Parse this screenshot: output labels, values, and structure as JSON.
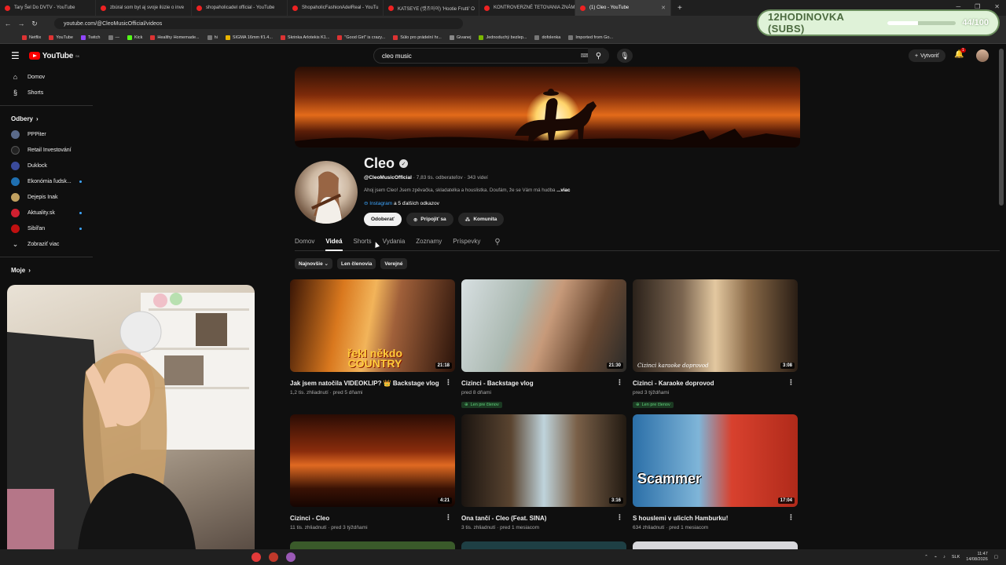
{
  "browser": {
    "tabs": [
      {
        "label": "Tary Šel Do DVTV - YouTube",
        "active": false
      },
      {
        "label": "zbúral som byt aj svoje ilúzie o inve",
        "active": false
      },
      {
        "label": "shopaholicadel official - YouTube",
        "active": false
      },
      {
        "label": "ShopaholicFashionAdelReal - YouTu",
        "active": false
      },
      {
        "label": "KATSEYE (캣츠아이) 'Hootie Frutti' O",
        "active": false
      },
      {
        "label": "KONTROVERZNÉ TETOVANIA ZNÁM",
        "active": false
      },
      {
        "label": "(1) Cleo - YouTube",
        "active": true
      }
    ],
    "url": "youtube.com/@CleoMusicOfficial/videos",
    "bookmarks": [
      "Netflix",
      "YouTube",
      "Twitch",
      "—",
      "Kick",
      "Healthy Homemade...",
      "hi",
      "SIGMA 16mm f/1.4...",
      "Skrinka Arlotekis K1...",
      "\"Good Girl\" is crazy...",
      "Súlo pro prádelní hr...",
      "Givanej",
      "Jednoduchý bezlep...",
      "dofolenka",
      "Imported from Go..."
    ]
  },
  "overlay": {
    "title": "12HODINOVKA (SUBS)",
    "count": "44/100",
    "progress": 0.44
  },
  "header": {
    "logo_text": "YouTube",
    "region": "SK",
    "search_value": "cleo music",
    "create_label": "Vytvoriť",
    "notif_count": "1"
  },
  "sidebar": {
    "main": [
      {
        "label": "Domov",
        "icon": "home-icon"
      },
      {
        "label": "Shorts",
        "icon": "shorts-icon"
      }
    ],
    "subs_title": "Odbery",
    "subs": [
      {
        "label": "PPPiter",
        "color": "#5a6a8a",
        "dot": false
      },
      {
        "label": "Retail Investování",
        "color": "#222222",
        "dot": false
      },
      {
        "label": "Duklock",
        "color": "#3a4a9a",
        "dot": false
      },
      {
        "label": "Ekonómia ľudsk...",
        "color": "#1f6fb0",
        "dot": true
      },
      {
        "label": "Dejepis Inak",
        "color": "#c0a060",
        "dot": false
      },
      {
        "label": "Aktuality.sk",
        "color": "#d02030",
        "dot": true
      },
      {
        "label": "Sibířan",
        "color": "#c01010",
        "dot": true
      }
    ],
    "show_more": "Zobraziť viac",
    "mine_title": "Moje"
  },
  "channel": {
    "name": "Cleo",
    "handle": "@CleoMusicOfficial",
    "stats": "· 7,83 tis. odberateľov · 343 videí",
    "description": "Ahoj jsem Cleo! Jsem zpěvačka, skladatelka a houslistka. Doufám, že se Vám má hudba",
    "more": "...viac",
    "link_label": "Instagram",
    "link_more": "a 5 ďalších odkazov",
    "buttons": {
      "subscribed": "Odoberať",
      "join": "Pripojiť sa",
      "community": "Komunita"
    }
  },
  "tabs": [
    "Domov",
    "Videá",
    "Shorts",
    "Vydania",
    "Zoznamy",
    "Príspevky"
  ],
  "active_tab": "Videá",
  "chips": [
    "Najnovšie",
    "Len členovia",
    "Verejné"
  ],
  "videos": [
    {
      "title": "Jak jsem natočila VIDEOKLIP? 👑 Backstage vlog",
      "meta": "1,2 tis. zhliadnutí · pred 5 dňami",
      "duration": "21:18",
      "members": "",
      "thumb_text": "řekl někdo COUNTRY"
    },
    {
      "title": "Cizinci - Backstage vlog",
      "meta": "pred 8 dňami",
      "duration": "21:30",
      "members": "Len pre členov",
      "thumb_text": ""
    },
    {
      "title": "Cizinci - Karaoke doprovod",
      "meta": "pred 3 týždňami",
      "duration": "3:08",
      "members": "Len pre členov",
      "thumb_text": "Cizinci karaoke doprovod"
    },
    {
      "title": "Cizinci - Cleo",
      "meta": "11 tis. zhliadnutí · pred 3 týždňami",
      "duration": "4:21",
      "members": "",
      "thumb_text": ""
    },
    {
      "title": "Ona tančí - Cleo (Feat. SINA)",
      "meta": "3 tis. zhliadnutí · pred 1 mesiacom",
      "duration": "3:16",
      "members": "",
      "thumb_text": ""
    },
    {
      "title": "S houslemi v ulicích Hamburku!",
      "meta": "634 zhliadnutí · pred 1 mesiacom",
      "duration": "17:04",
      "members": "",
      "thumb_text": "Scammer"
    }
  ],
  "taskbar": {
    "lang": "SLK",
    "time": "11:47",
    "date": "14/08/2026"
  }
}
